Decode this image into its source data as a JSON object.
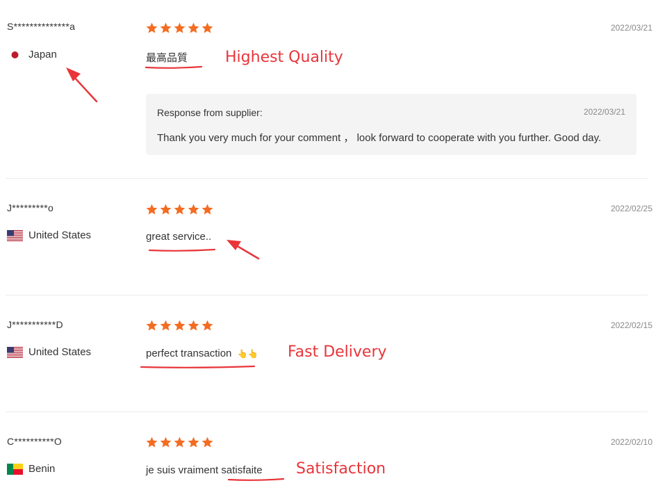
{
  "reviews": [
    {
      "buyer": "S**************a",
      "country": "Japan",
      "rating": 5,
      "date": "2022/03/21",
      "comment": "最高品質",
      "annotation": "Highest Quality",
      "response": {
        "label": "Response from supplier:",
        "date": "2022/03/21",
        "text": "Thank you very much for your comment ， look forward to cooperate with you further. Good day."
      }
    },
    {
      "buyer": "J*********o",
      "country": "United States",
      "rating": 5,
      "date": "2022/02/25",
      "comment": "great service..",
      "annotation": ""
    },
    {
      "buyer": "J***********D",
      "country": "United States",
      "rating": 5,
      "date": "2022/02/15",
      "comment": "perfect transaction",
      "comment_emoji": "👆👆",
      "annotation": "Fast Delivery"
    },
    {
      "buyer": "C**********O",
      "country": "Benin",
      "rating": 5,
      "date": "2022/02/10",
      "comment": "je suis vraiment satisfaite",
      "annotation": "Satisfaction"
    }
  ],
  "colors": {
    "star": "#f36c21",
    "annotation": "#e8353a",
    "response_bg": "#f4f4f4"
  }
}
